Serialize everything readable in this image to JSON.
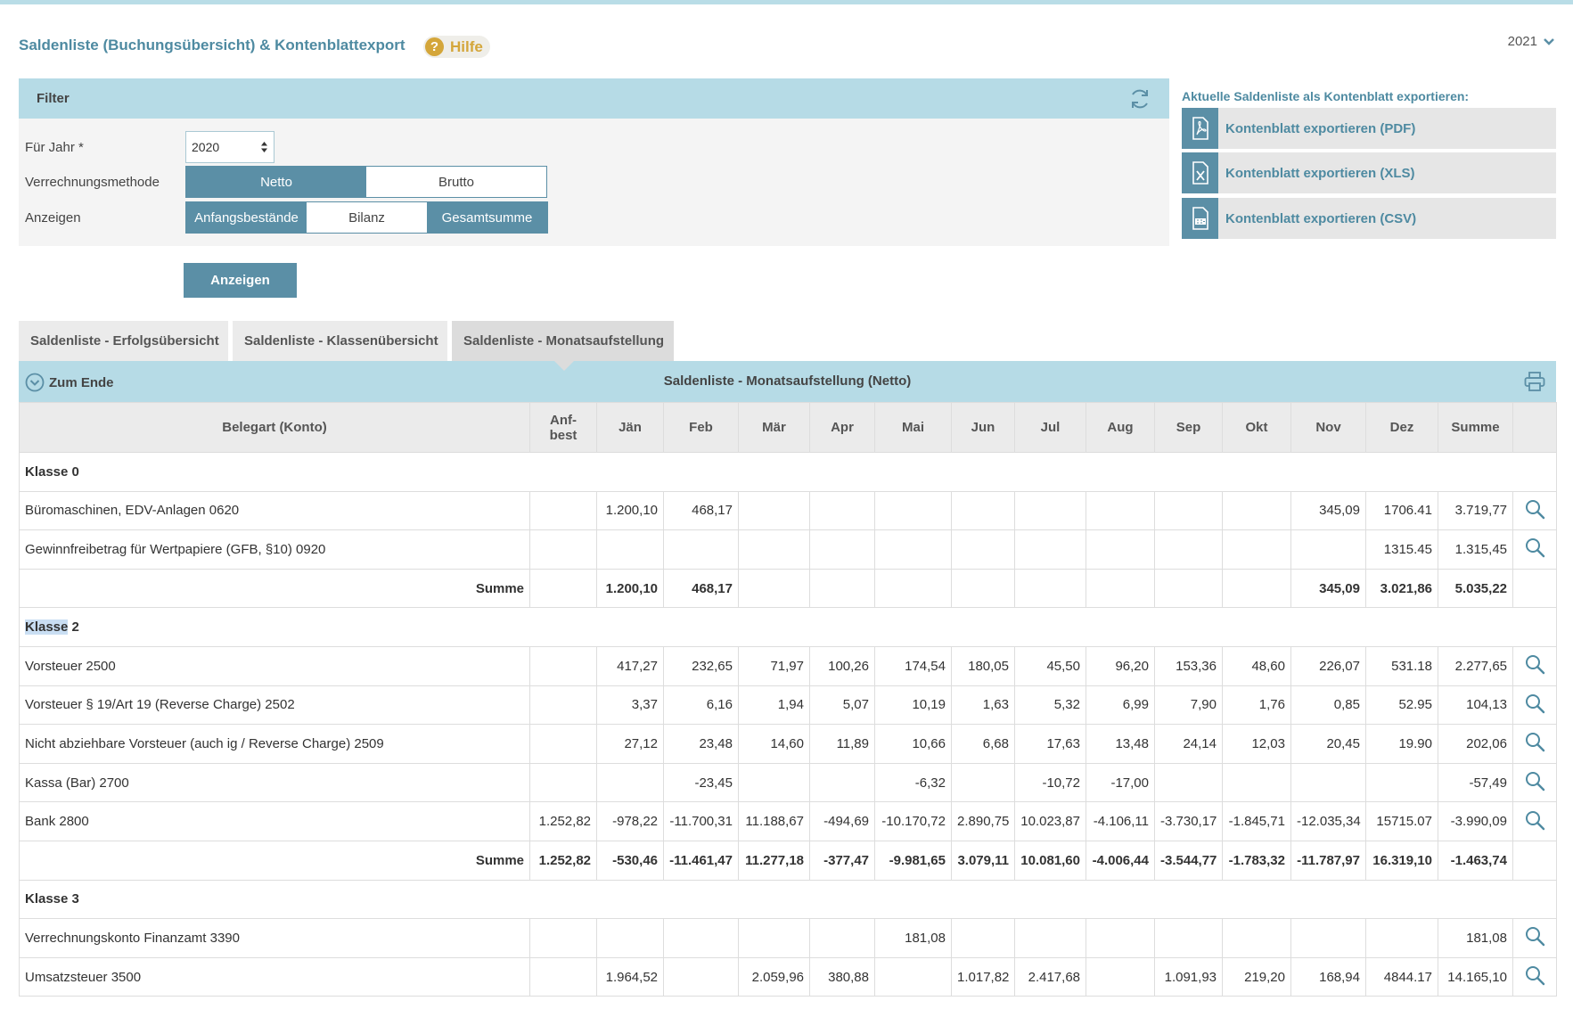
{
  "header": {
    "title": "Saldenliste (Buchungsübersicht) & Kontenblattexport",
    "help_label": "Hilfe",
    "year_select": "2021"
  },
  "filter": {
    "title": "Filter",
    "jahr_label": "Für Jahr *",
    "jahr_value": "2020",
    "methode_label": "Verrechnungsmethode",
    "methode_options": [
      "Netto",
      "Brutto"
    ],
    "anzeigen_label": "Anzeigen",
    "anzeigen_options": [
      "Anfangsbestände",
      "Bilanz",
      "Gesamtsumme"
    ],
    "submit_label": "Anzeigen"
  },
  "export": {
    "title": "Aktuelle Saldenliste als Kontenblatt exportieren:",
    "buttons": [
      "Kontenblatt exportieren (PDF)",
      "Kontenblatt exportieren (XLS)",
      "Kontenblatt exportieren (CSV)"
    ]
  },
  "tabs": [
    "Saldenliste - Erfolgsübersicht",
    "Saldenliste - Klassenübersicht",
    "Saldenliste - Monatsaufstellung"
  ],
  "table": {
    "zum_ende": "Zum Ende",
    "title": "Saldenliste - Monatsaufstellung (Netto)",
    "columns": [
      "Belegart (Konto)",
      "Anf-\nbest",
      "Jän",
      "Feb",
      "Mär",
      "Apr",
      "Mai",
      "Jun",
      "Jul",
      "Aug",
      "Sep",
      "Okt",
      "Nov",
      "Dez",
      "Summe"
    ],
    "rows": [
      {
        "type": "klasse",
        "label": "Klasse 0"
      },
      {
        "type": "row",
        "cells": [
          "Büromaschinen, EDV-Anlagen 0620",
          "",
          "1.200,10",
          "468,17",
          "",
          "",
          "",
          "",
          "",
          "",
          "",
          "",
          "345,09",
          "1706.41",
          "3.719,77"
        ]
      },
      {
        "type": "row",
        "cells": [
          "Gewinnfreibetrag für Wertpapiere (GFB, §10) 0920",
          "",
          "",
          "",
          "",
          "",
          "",
          "",
          "",
          "",
          "",
          "",
          "",
          "1315.45",
          "1.315,45"
        ]
      },
      {
        "type": "sum",
        "cells": [
          "Summe",
          "",
          "1.200,10",
          "468,17",
          "",
          "",
          "",
          "",
          "",
          "",
          "",
          "",
          "345,09",
          "3.021,86",
          "5.035,22"
        ]
      },
      {
        "type": "klasse",
        "label_hl": "Klasse",
        "label_rest": " 2"
      },
      {
        "type": "row",
        "cells": [
          "Vorsteuer 2500",
          "",
          "417,27",
          "232,65",
          "71,97",
          "100,26",
          "174,54",
          "180,05",
          "45,50",
          "96,20",
          "153,36",
          "48,60",
          "226,07",
          "531.18",
          "2.277,65"
        ]
      },
      {
        "type": "row",
        "cells": [
          "Vorsteuer § 19/Art 19 (Reverse Charge) 2502",
          "",
          "3,37",
          "6,16",
          "1,94",
          "5,07",
          "10,19",
          "1,63",
          "5,32",
          "6,99",
          "7,90",
          "1,76",
          "0,85",
          "52.95",
          "104,13"
        ]
      },
      {
        "type": "row",
        "cells": [
          "Nicht abziehbare Vorsteuer (auch ig / Reverse Charge) 2509",
          "",
          "27,12",
          "23,48",
          "14,60",
          "11,89",
          "10,66",
          "6,68",
          "17,63",
          "13,48",
          "24,14",
          "12,03",
          "20,45",
          "19.90",
          "202,06"
        ]
      },
      {
        "type": "row",
        "cells": [
          "Kassa (Bar) 2700",
          "",
          "",
          "-23,45",
          "",
          "",
          "-6,32",
          "",
          "-10,72",
          "-17,00",
          "",
          "",
          "",
          "",
          "-57,49"
        ]
      },
      {
        "type": "row",
        "cells": [
          "Bank 2800",
          "1.252,82",
          "-978,22",
          "-11.700,31",
          "11.188,67",
          "-494,69",
          "-10.170,72",
          "2.890,75",
          "10.023,87",
          "-4.106,11",
          "-3.730,17",
          "-1.845,71",
          "-12.035,34",
          "15715.07",
          "-3.990,09"
        ]
      },
      {
        "type": "sum",
        "cells": [
          "Summe",
          "1.252,82",
          "-530,46",
          "-11.461,47",
          "11.277,18",
          "-377,47",
          "-9.981,65",
          "3.079,11",
          "10.081,60",
          "-4.006,44",
          "-3.544,77",
          "-1.783,32",
          "-11.787,97",
          "16.319,10",
          "-1.463,74"
        ]
      },
      {
        "type": "klasse",
        "label": "Klasse 3"
      },
      {
        "type": "row",
        "cells": [
          "Verrechnungskonto Finanzamt 3390",
          "",
          "",
          "",
          "",
          "",
          "181,08",
          "",
          "",
          "",
          "",
          "",
          "",
          "",
          "181,08"
        ]
      },
      {
        "type": "row",
        "cells": [
          "Umsatzsteuer 3500",
          "",
          "1.964,52",
          "",
          "2.059,96",
          "380,88",
          "",
          "1.017,82",
          "2.417,68",
          "",
          "1.091,93",
          "219,20",
          "168,94",
          "4844.17",
          "14.165,10"
        ]
      }
    ]
  },
  "colors": {
    "accent": "#5b8fa6",
    "header_bg": "#b6dbe6",
    "title": "#4e8aa1",
    "help": "#d4a63a"
  }
}
